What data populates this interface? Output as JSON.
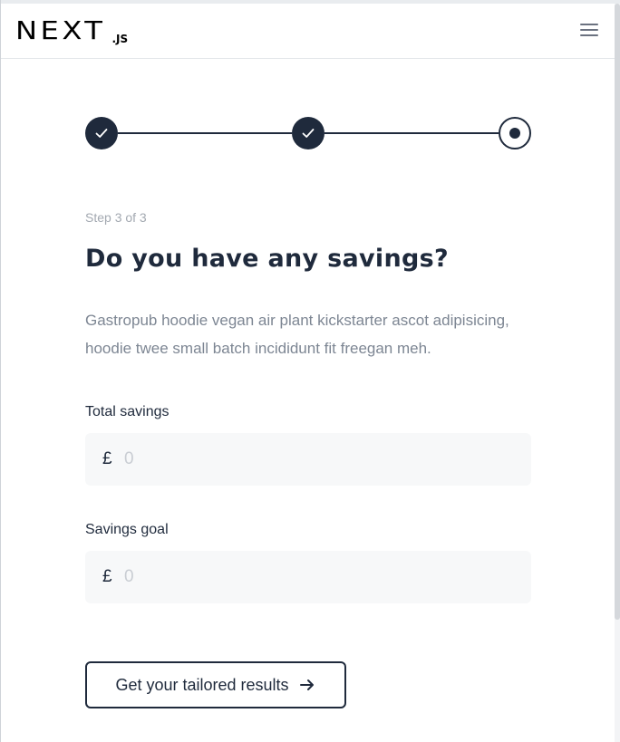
{
  "header": {
    "logo_main": "NEXT",
    "logo_sub": ".JS",
    "menu_icon": "hamburger-menu-icon"
  },
  "stepper": {
    "steps": [
      {
        "state": "complete",
        "icon": "check-icon"
      },
      {
        "state": "complete",
        "icon": "check-icon"
      },
      {
        "state": "current",
        "icon": "dot-icon"
      }
    ],
    "current_step": 3,
    "total_steps": 3
  },
  "form": {
    "step_label": "Step 3 of 3",
    "title": "Do you have any savings?",
    "description": "Gastropub hoodie vegan air plant kickstarter ascot adipisicing, hoodie twee small batch incididunt fit freegan meh.",
    "fields": [
      {
        "label": "Total savings",
        "currency": "£",
        "placeholder": "0",
        "value": ""
      },
      {
        "label": "Savings goal",
        "currency": "£",
        "placeholder": "0",
        "value": ""
      }
    ],
    "submit_label": "Get your tailored results",
    "submit_icon": "arrow-right-icon"
  },
  "colors": {
    "primary": "#1f2a3c",
    "muted_text": "#7d8693",
    "step_counter": "#a3a9b1",
    "field_bg": "#f7f8f9"
  }
}
